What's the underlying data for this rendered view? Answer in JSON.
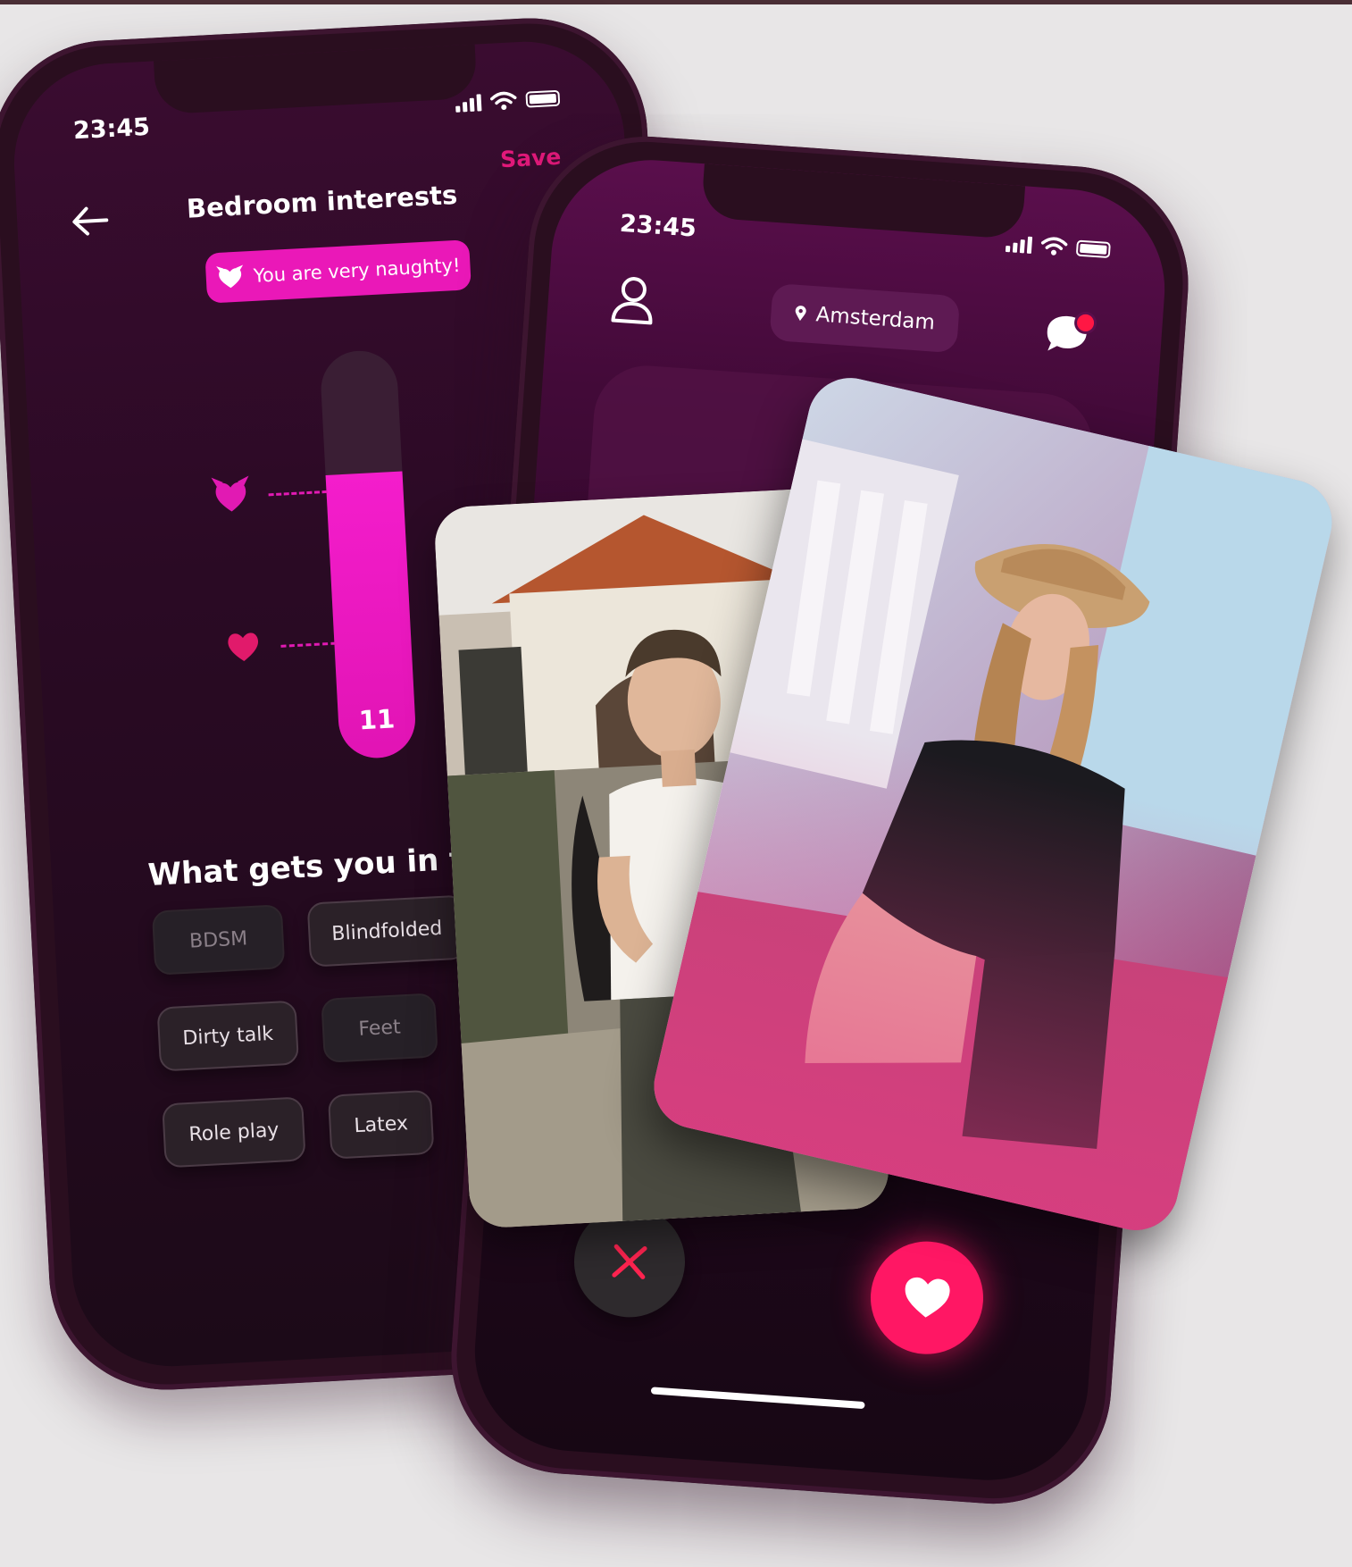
{
  "phone_left": {
    "status_time": "23:45",
    "title": "Bedroom interests",
    "save_label": "Save",
    "badge_text": "You are very naughty!",
    "slider": {
      "value_label": "11",
      "level_fraction": 0.7
    },
    "question": "What gets you in the mo",
    "chips": [
      {
        "label": "BDSM",
        "selected": false
      },
      {
        "label": "Blindfolded",
        "selected": true
      },
      {
        "label": "Dirty talk",
        "selected": true
      },
      {
        "label": "Feet",
        "selected": false
      },
      {
        "label": "Role play",
        "selected": true
      },
      {
        "label": "Latex",
        "selected": true
      }
    ]
  },
  "phone_right": {
    "status_time": "23:45",
    "location": "Amsterdam",
    "icons": {
      "profile": "profile-icon",
      "location_pin": "pin-icon",
      "chat": "chat-icon",
      "dislike": "close-icon",
      "like": "heart-icon"
    }
  },
  "colors": {
    "accent_pink": "#ea18b8",
    "save_red": "#e1197a",
    "like_red": "#ff1764",
    "bg_dark": "#2a0e1f"
  }
}
